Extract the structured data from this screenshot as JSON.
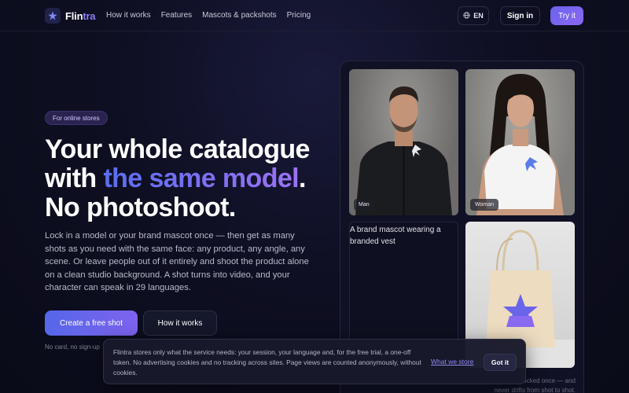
{
  "brand": {
    "name_prefix": "Flin",
    "name_suffix": "tra"
  },
  "nav": {
    "links": [
      "How it works",
      "Features",
      "Mascots & packshots",
      "Pricing"
    ],
    "language": "EN",
    "signin": "Sign in",
    "try": "Try it"
  },
  "hero": {
    "badge": "For online stores",
    "headline_line1": "Your whole catalogue",
    "headline_with": "with ",
    "headline_highlight": "the same model",
    "headline_period": ".",
    "headline_line3": "No photoshoot.",
    "lede": "Lock in a model or your brand mascot once — then get as many shots as you need with the same face: any product, any angle, any scene. Or leave people out of it entirely and shoot the product alone on a clean studio background. A shot turns into video, and your character can speak in 29 languages.",
    "cta_primary": "Create a free shot",
    "cta_secondary": "How it works",
    "note": "No card, no sign-up"
  },
  "gallery": {
    "tiles": [
      {
        "label": "Man"
      },
      {
        "label": "Woman"
      },
      {
        "alt": "A brand mascot wearing a branded vest"
      },
      {
        "label": ""
      }
    ],
    "caption_line1": "locked once — and",
    "caption_line2": "never drifts from shot to shot."
  },
  "cookie": {
    "text": "Flintra stores only what the service needs: your session, your language and, for the free trial, a one-off token. No advertising cookies and no tracking across sites. Page views are counted anonymously, without cookies.",
    "link": "What we store",
    "button": "Got it"
  },
  "colors": {
    "accent": "#7b68f2",
    "background": "#0e0f22",
    "primary_button": "#5f66ec"
  }
}
